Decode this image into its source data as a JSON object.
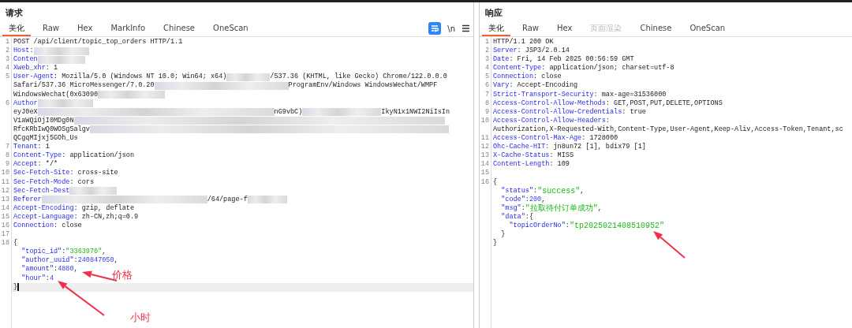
{
  "request": {
    "title": "请求",
    "tabs": [
      {
        "label": "美化",
        "selected": true,
        "disabled": false
      },
      {
        "label": "Raw",
        "selected": false,
        "disabled": false
      },
      {
        "label": "Hex",
        "selected": false,
        "disabled": false
      },
      {
        "label": "MarkInfo",
        "selected": false,
        "disabled": false
      },
      {
        "label": "Chinese",
        "selected": false,
        "disabled": false
      },
      {
        "label": "OneScan",
        "selected": false,
        "disabled": false
      }
    ],
    "toolbar": {
      "wrap_on": true,
      "newline_label": "\\n"
    },
    "lines": [
      {
        "no": "1",
        "current": false,
        "parts": [
          {
            "kind": "plain",
            "text": "POST /api/client/topic_top_orders HTTP/1.1"
          }
        ]
      },
      {
        "no": "2",
        "current": false,
        "parts": [
          {
            "kind": "key",
            "text": "Host"
          },
          {
            "kind": "plain",
            "text": ":"
          },
          {
            "kind": "blur"
          }
        ]
      },
      {
        "no": "3",
        "current": false,
        "parts": [
          {
            "kind": "key",
            "text": "Conten"
          },
          {
            "kind": "blur"
          }
        ]
      },
      {
        "no": "4",
        "current": false,
        "parts": [
          {
            "kind": "key",
            "text": "Xweb_xhr"
          },
          {
            "kind": "plain",
            "text": ": 1"
          }
        ]
      },
      {
        "no": "5",
        "current": false,
        "parts": [
          {
            "kind": "key",
            "text": "User-Agent"
          },
          {
            "kind": "plain",
            "text": ": Mozilla/5.0 (Windows NT 10.0; Win64; x64)"
          },
          {
            "kind": "blur"
          },
          {
            "kind": "plain",
            "text": "/537.36 (KHTML, like Gecko) Chrome/122.0.0.0"
          }
        ]
      },
      {
        "current": false,
        "parts": [
          {
            "kind": "plain",
            "text": "Safari/537.36 MicroMessenger/7.0.20"
          },
          {
            "kind": "blur"
          },
          {
            "kind": "plain",
            "text": "ProgramEnv/Windows WindowsWechat/WMPF"
          }
        ]
      },
      {
        "current": false,
        "parts": [
          {
            "kind": "plain",
            "text": "WindowsWechat(0x63090"
          },
          {
            "kind": "blur"
          }
        ]
      },
      {
        "no": "6",
        "current": false,
        "parts": [
          {
            "kind": "key",
            "text": "Author"
          },
          {
            "kind": "blur"
          }
        ]
      },
      {
        "current": false,
        "parts": [
          {
            "kind": "plain",
            "text": "eyJ0eX"
          },
          {
            "kind": "blur"
          },
          {
            "kind": "plain",
            "text": "nG9vbC)"
          },
          {
            "kind": "blur"
          },
          {
            "kind": "plain",
            "text": "IkyN1x1NWI2NiIsIn"
          }
        ]
      },
      {
        "current": false,
        "parts": [
          {
            "kind": "plain",
            "text": "V1aWQiOjI0MDg0N"
          },
          {
            "kind": "blur"
          }
        ]
      },
      {
        "current": false,
        "parts": [
          {
            "kind": "plain",
            "text": "RfcKRbIwQ0WOSg5algv"
          },
          {
            "kind": "blur"
          }
        ]
      },
      {
        "current": false,
        "parts": [
          {
            "kind": "plain",
            "text": "QCgqMIjxj5GOh_Us"
          }
        ]
      },
      {
        "no": "7",
        "current": false,
        "parts": [
          {
            "kind": "key",
            "text": "Tenant"
          },
          {
            "kind": "plain",
            "text": ": 1"
          }
        ]
      },
      {
        "no": "8",
        "current": false,
        "parts": [
          {
            "kind": "key",
            "text": "Content-Type"
          },
          {
            "kind": "plain",
            "text": ": application/json"
          }
        ]
      },
      {
        "no": "9",
        "current": false,
        "parts": [
          {
            "kind": "key",
            "text": "Accept"
          },
          {
            "kind": "plain",
            "text": ": */*"
          }
        ]
      },
      {
        "no": "10",
        "current": false,
        "parts": [
          {
            "kind": "key",
            "text": "Sec-Fetch-Site"
          },
          {
            "kind": "plain",
            "text": ": cross-site"
          }
        ]
      },
      {
        "no": "11",
        "current": false,
        "parts": [
          {
            "kind": "key",
            "text": "Sec-Fetch-Mode"
          },
          {
            "kind": "plain",
            "text": ": cors"
          }
        ]
      },
      {
        "no": "12",
        "current": false,
        "parts": [
          {
            "kind": "key",
            "text": "Sec-Fetch-Dest"
          },
          {
            "kind": "blur"
          }
        ]
      },
      {
        "no": "13",
        "current": false,
        "parts": [
          {
            "kind": "key",
            "text": "Referer"
          },
          {
            "kind": "blur"
          },
          {
            "kind": "plain",
            "text": "/64/page-f"
          },
          {
            "kind": "blur"
          }
        ]
      },
      {
        "no": "14",
        "current": false,
        "parts": [
          {
            "kind": "key",
            "text": "Accept-Encoding"
          },
          {
            "kind": "plain",
            "text": ": gzip, deflate"
          }
        ]
      },
      {
        "no": "15",
        "current": false,
        "parts": [
          {
            "kind": "key",
            "text": "Accept-Language"
          },
          {
            "kind": "plain",
            "text": ": zh-CN,zh;q=0.9"
          }
        ]
      },
      {
        "no": "16",
        "current": false,
        "parts": [
          {
            "kind": "key",
            "text": "Connection"
          },
          {
            "kind": "plain",
            "text": ": close"
          }
        ]
      },
      {
        "no": "17",
        "current": false
      },
      {
        "no": "18",
        "current": false,
        "parts": [
          {
            "kind": "plain",
            "text": "{"
          }
        ]
      },
      {
        "current": false,
        "parts": [
          {
            "kind": "key",
            "text": "  \"topic_id\""
          },
          {
            "kind": "plain",
            "text": ":"
          },
          {
            "kind": "str",
            "text": "\"3363970\""
          },
          {
            "kind": "plain",
            "text": ","
          }
        ]
      },
      {
        "current": false,
        "parts": [
          {
            "kind": "key",
            "text": "  \"author_uuid\""
          },
          {
            "kind": "plain",
            "text": ":"
          },
          {
            "kind": "num",
            "text": "240847050"
          },
          {
            "kind": "plain",
            "text": ","
          }
        ]
      },
      {
        "current": false,
        "parts": [
          {
            "kind": "key",
            "text": "  \"amount\""
          },
          {
            "kind": "plain",
            "text": ":"
          },
          {
            "kind": "num",
            "text": "4880"
          },
          {
            "kind": "plain",
            "text": ","
          }
        ]
      },
      {
        "current": false,
        "parts": [
          {
            "kind": "key",
            "text": "  \"hour\""
          },
          {
            "kind": "plain",
            "text": ":"
          },
          {
            "kind": "num",
            "text": "4"
          }
        ]
      },
      {
        "current": true,
        "parts": [
          {
            "kind": "plain",
            "text": "}"
          }
        ]
      }
    ],
    "annotations": [
      {
        "label": "价格"
      },
      {
        "label": "小时"
      }
    ]
  },
  "response": {
    "title": "响应",
    "tabs": [
      {
        "label": "美化",
        "selected": true,
        "disabled": false
      },
      {
        "label": "Raw",
        "selected": false,
        "disabled": false
      },
      {
        "label": "Hex",
        "selected": false,
        "disabled": false
      },
      {
        "label": "页面渲染",
        "selected": false,
        "disabled": true
      },
      {
        "label": "Chinese",
        "selected": false,
        "disabled": false
      },
      {
        "label": "OneScan",
        "selected": false,
        "disabled": false
      }
    ],
    "lines": [
      {
        "no": "1",
        "current": false,
        "parts": [
          {
            "kind": "plain",
            "text": "HTTP/1.1 200 OK"
          }
        ]
      },
      {
        "no": "2",
        "current": false,
        "parts": [
          {
            "kind": "key",
            "text": "Server"
          },
          {
            "kind": "plain",
            "text": ": JSP3/2.0.14"
          }
        ]
      },
      {
        "no": "3",
        "current": false,
        "parts": [
          {
            "kind": "key",
            "text": "Date"
          },
          {
            "kind": "plain",
            "text": ": Fri, 14 Feb 2025 00:56:59 GMT"
          }
        ]
      },
      {
        "no": "4",
        "current": false,
        "parts": [
          {
            "kind": "key",
            "text": "Content-Type"
          },
          {
            "kind": "plain",
            "text": ": application/json; charset=utf-8"
          }
        ]
      },
      {
        "no": "5",
        "current": false,
        "parts": [
          {
            "kind": "key",
            "text": "Connection"
          },
          {
            "kind": "plain",
            "text": ": close"
          }
        ]
      },
      {
        "no": "6",
        "current": false,
        "parts": [
          {
            "kind": "key",
            "text": "Vary"
          },
          {
            "kind": "plain",
            "text": ": Accept-Encoding"
          }
        ]
      },
      {
        "no": "7",
        "current": false,
        "parts": [
          {
            "kind": "key",
            "text": "Strict-Transport-Security"
          },
          {
            "kind": "plain",
            "text": ": max-age=31536000"
          }
        ]
      },
      {
        "no": "8",
        "current": false,
        "parts": [
          {
            "kind": "key",
            "text": "Access-Control-Allow-Methods"
          },
          {
            "kind": "plain",
            "text": ": GET,POST,PUT,DELETE,OPTIONS"
          }
        ]
      },
      {
        "no": "9",
        "current": false,
        "parts": [
          {
            "kind": "key",
            "text": "Access-Control-Allow-Credentials"
          },
          {
            "kind": "plain",
            "text": ": true"
          }
        ]
      },
      {
        "no": "10",
        "current": false,
        "parts": [
          {
            "kind": "key",
            "text": "Access-Control-Allow-Headers"
          },
          {
            "kind": "plain",
            "text": ":"
          }
        ]
      },
      {
        "current": false,
        "parts": [
          {
            "kind": "plain",
            "text": "Authorization,X-Requested-With,Content-Type,User-Agent,Keep-Aliv,Access-Token,Tenant,sc"
          }
        ]
      },
      {
        "no": "11",
        "current": false,
        "parts": [
          {
            "kind": "key",
            "text": "Access-Control-Max-Age"
          },
          {
            "kind": "plain",
            "text": ": 1728000"
          }
        ]
      },
      {
        "no": "12",
        "current": false,
        "parts": [
          {
            "kind": "key",
            "text": "Ohc-Cache-HIT"
          },
          {
            "kind": "plain",
            "text": ": jn8un72 [1], bdix79 [1]"
          }
        ]
      },
      {
        "no": "13",
        "current": false,
        "parts": [
          {
            "kind": "key",
            "text": "X-Cache-Status"
          },
          {
            "kind": "plain",
            "text": ": MISS"
          }
        ]
      },
      {
        "no": "14",
        "current": false,
        "parts": [
          {
            "kind": "key",
            "text": "Content-Length"
          },
          {
            "kind": "plain",
            "text": ": 109"
          }
        ]
      },
      {
        "no": "15",
        "current": false
      },
      {
        "no": "16",
        "current": false,
        "parts": [
          {
            "kind": "plain",
            "text": "{"
          }
        ]
      },
      {
        "current": false,
        "parts": [
          {
            "kind": "key",
            "text": "  \"status\""
          },
          {
            "kind": "plain",
            "text": ":"
          },
          {
            "kind": "str",
            "text": "\"success\""
          },
          {
            "kind": "plain",
            "text": ","
          }
        ]
      },
      {
        "current": false,
        "parts": [
          {
            "kind": "key",
            "text": "  \"code\""
          },
          {
            "kind": "plain",
            "text": ":"
          },
          {
            "kind": "num",
            "text": "200"
          },
          {
            "kind": "plain",
            "text": ","
          }
        ]
      },
      {
        "current": false,
        "parts": [
          {
            "kind": "key",
            "text": "  \"msg\""
          },
          {
            "kind": "plain",
            "text": ":"
          },
          {
            "kind": "str",
            "text": "\"拉取待付订单成功\""
          },
          {
            "kind": "plain",
            "text": ","
          }
        ]
      },
      {
        "current": false,
        "parts": [
          {
            "kind": "key",
            "text": "  \"data\""
          },
          {
            "kind": "plain",
            "text": ":{"
          }
        ]
      },
      {
        "current": false,
        "parts": [
          {
            "kind": "key",
            "text": "    \"topicOrderNo\""
          },
          {
            "kind": "plain",
            "text": ":"
          },
          {
            "kind": "str",
            "text": "\"tp2025021408510952\""
          }
        ]
      },
      {
        "current": false,
        "parts": [
          {
            "kind": "plain",
            "text": "  }"
          }
        ]
      },
      {
        "current": false,
        "parts": [
          {
            "kind": "plain",
            "text": "}"
          }
        ]
      }
    ]
  }
}
